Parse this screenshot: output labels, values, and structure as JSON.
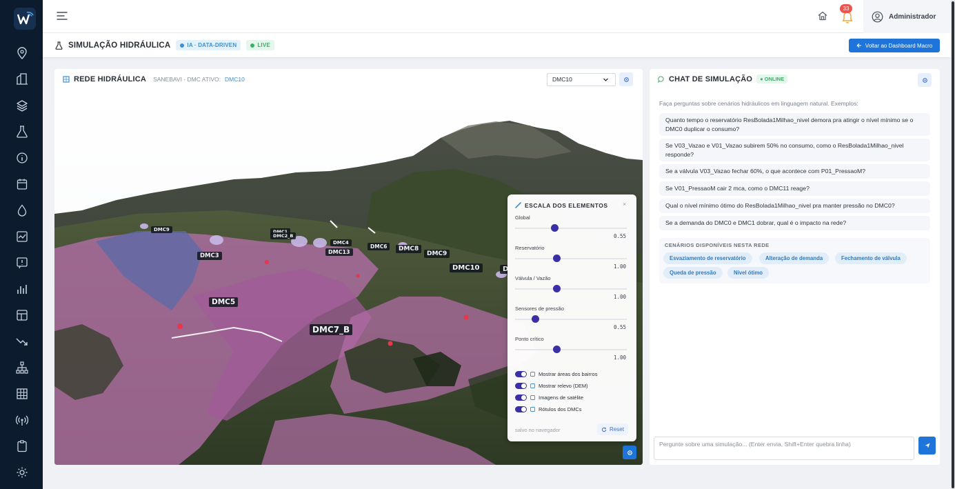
{
  "sidebar": {
    "logo": "W",
    "items": [
      {
        "icon": "map-pin-icon"
      },
      {
        "icon": "buildings-icon"
      },
      {
        "icon": "layers-icon"
      },
      {
        "icon": "flask-icon"
      },
      {
        "icon": "info-icon"
      },
      {
        "icon": "calendar-icon"
      },
      {
        "icon": "droplet-icon"
      },
      {
        "icon": "activity-icon"
      },
      {
        "icon": "alert-icon"
      },
      {
        "icon": "bar-chart-icon"
      },
      {
        "icon": "layout-icon"
      },
      {
        "icon": "trending-down-icon"
      },
      {
        "icon": "network-icon"
      },
      {
        "icon": "grid-icon"
      },
      {
        "icon": "signal-icon"
      },
      {
        "icon": "clipboard-icon"
      },
      {
        "icon": "settings-icon"
      }
    ]
  },
  "topbar": {
    "notifications_count": "33",
    "user_name": "Administrador"
  },
  "page": {
    "title": "SIMULAÇÃO HIDRÁULICA",
    "badge_ia": "IA · DATA-DRIVEN",
    "badge_live": "LIVE",
    "back_button": "Voltar ao Dashboard Macro"
  },
  "map": {
    "title": "REDE HIDRÁULICA",
    "subtitle": "SANEBAVI · DMC ATIVO:",
    "active_dmc": "DMC10",
    "select_value": "DMC10",
    "labels": [
      {
        "text": "DMC9"
      },
      {
        "text": "DMC1"
      },
      {
        "text": "DMC2_B"
      },
      {
        "text": "DMC3"
      },
      {
        "text": "DMC4"
      },
      {
        "text": "DMC13"
      },
      {
        "text": "DMC6"
      },
      {
        "text": "DMC8"
      },
      {
        "text": "DMC9"
      },
      {
        "text": "DMC10"
      },
      {
        "text": "D"
      },
      {
        "text": "DMC5"
      },
      {
        "text": "DMC7_B"
      }
    ]
  },
  "scale_panel": {
    "title": "ESCALA DOS ELEMENTOS",
    "close": "×",
    "sliders": [
      {
        "label": "Global",
        "value": "0.55",
        "fraction": 0.35
      },
      {
        "label": "Reservatório",
        "value": "1.00",
        "fraction": 0.37
      },
      {
        "label": "Válvula / Vazão",
        "value": "1.00",
        "fraction": 0.37
      },
      {
        "label": "Sensores de pressão",
        "value": "0.55",
        "fraction": 0.18
      },
      {
        "label": "Ponto crítico",
        "value": "1.00",
        "fraction": 0.37
      }
    ],
    "toggles": [
      {
        "label": "Mostrar áreas dos bairros",
        "on": true
      },
      {
        "label": "Mostrar relevo (DEM)",
        "on": true
      },
      {
        "label": "Imagens de satélite",
        "on": true
      },
      {
        "label": "Rótulos dos DMCs",
        "on": true
      }
    ],
    "saved_note": "salvo no navegador",
    "reset_label": "Reset"
  },
  "chat": {
    "title": "CHAT DE SIMULAÇÃO",
    "status": "● ONLINE",
    "intro": "Faça perguntas sobre cenários hidráulicos em linguagem natural. Exemplos:",
    "suggestions": [
      "Quanto tempo o reservatório ResBolada1Milhao_nivel demora pra atingir o nível mínimo se o DMC0 duplicar o consumo?",
      "Se V03_Vazao e V01_Vazao subirem 50% no consumo, como o ResBolada1Milhao_nivel responde?",
      "Se a válvula V03_Vazao fechar 60%, o que acontece com P01_PressaoM?",
      "Se V01_PressaoM cair 2 mca, como o DMC11 reage?",
      "Qual o nível mínimo ótimo do ResBolada1Milhao_nivel pra manter pressão no DMC0?",
      "Se a demanda do DMC0 e DMC1 dobrar, qual é o impacto na rede?"
    ],
    "scenarios_title": "CENÁRIOS DISPONÍVEIS NESTA REDE",
    "scenarios": [
      "Esvaziamento de reservatório",
      "Alteração de demanda",
      "Fechamento de válvula",
      "Queda de pressão",
      "Nível ótimo"
    ],
    "input_placeholder": "Pergunte sobre uma simulação... (Enter envia, Shift+Enter quebra linha)",
    "input_value": ""
  },
  "colors": {
    "sidebar_bg": "#0d1b2e",
    "accent": "#1e74d8",
    "slider": "#3b2fa6",
    "live_green": "#3eae6a",
    "ia_blue": "#3e8ed0"
  }
}
